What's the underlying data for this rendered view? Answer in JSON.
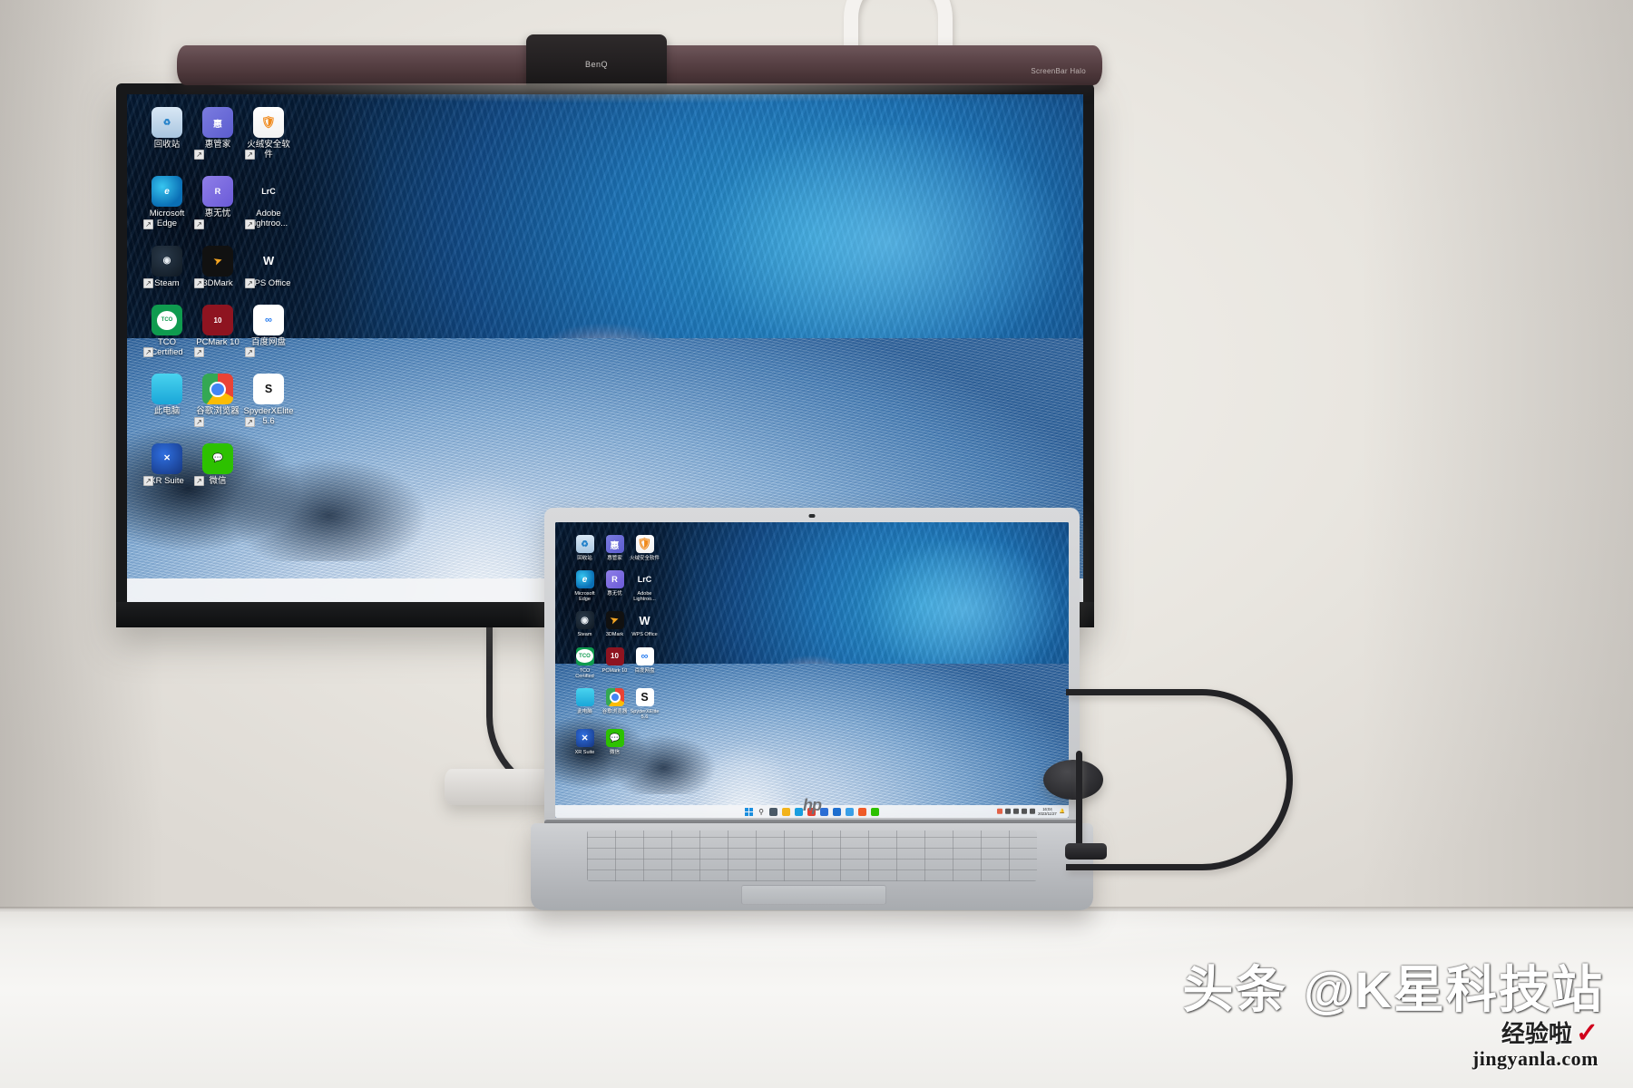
{
  "scene": {
    "description": "Desk setup photo: BenQ ScreenBar Halo light bar on a monitor, HP laptop in front, both showing the same Windows 11 ice-cave wallpaper desktop"
  },
  "lightbar": {
    "brand": "BenQ",
    "model": "ScreenBar Halo"
  },
  "laptop": {
    "brand_logo": "hp"
  },
  "monitor_desktop": {
    "icons": [
      {
        "label": "回收站",
        "icon": "recycle-bin-icon",
        "shortcut": false
      },
      {
        "label": "惠管家",
        "icon": "hui-manager-icon",
        "shortcut": true
      },
      {
        "label": "火绒安全软件",
        "icon": "huorong-security-icon",
        "shortcut": true
      },
      {
        "label": "Microsoft Edge",
        "icon": "microsoft-edge-icon",
        "shortcut": true
      },
      {
        "label": "惠无忧",
        "icon": "huiwuyou-icon",
        "shortcut": true
      },
      {
        "label": "Adobe Lightroo...",
        "icon": "adobe-lightroom-classic-icon",
        "shortcut": true
      },
      {
        "label": "Steam",
        "icon": "steam-icon",
        "shortcut": true
      },
      {
        "label": "3DMark",
        "icon": "3dmark-icon",
        "shortcut": true
      },
      {
        "label": "WPS Office",
        "icon": "wps-office-icon",
        "shortcut": true
      },
      {
        "label": "TCO Certified",
        "icon": "tco-certified-icon",
        "shortcut": true
      },
      {
        "label": "PCMark 10",
        "icon": "pcmark-10-icon",
        "shortcut": true
      },
      {
        "label": "百度网盘",
        "icon": "baidu-netdisk-icon",
        "shortcut": true
      },
      {
        "label": "此电脑",
        "icon": "this-pc-icon",
        "shortcut": false
      },
      {
        "label": "谷歌浏览器",
        "icon": "google-chrome-icon",
        "shortcut": true
      },
      {
        "label": "SpyderXElite 5.6",
        "icon": "spyderx-elite-icon",
        "shortcut": true
      },
      {
        "label": "XR Suite",
        "icon": "xr-suite-icon",
        "shortcut": true
      },
      {
        "label": "微信",
        "icon": "wechat-icon",
        "shortcut": true
      }
    ],
    "taskbar": {
      "items": [
        {
          "name": "start-button",
          "icon": "windows-logo-icon"
        },
        {
          "name": "search-button",
          "icon": "search-icon"
        },
        {
          "name": "widgets-button",
          "icon": "widgets-icon"
        }
      ]
    }
  },
  "laptop_desktop": {
    "icons": [
      {
        "label": "回收站",
        "icon": "recycle-bin-icon"
      },
      {
        "label": "惠管家",
        "icon": "hui-manager-icon"
      },
      {
        "label": "火绒安全软件",
        "icon": "huorong-security-icon"
      },
      {
        "label": "Microsoft Edge",
        "icon": "microsoft-edge-icon"
      },
      {
        "label": "惠无忧",
        "icon": "huiwuyou-icon"
      },
      {
        "label": "Adobe Lightroo...",
        "icon": "adobe-lightroom-classic-icon"
      },
      {
        "label": "Steam",
        "icon": "steam-icon"
      },
      {
        "label": "3DMark",
        "icon": "3dmark-icon"
      },
      {
        "label": "WPS Office",
        "icon": "wps-office-icon"
      },
      {
        "label": "TCO Certified",
        "icon": "tco-certified-icon"
      },
      {
        "label": "PCMark 10",
        "icon": "pcmark-10-icon"
      },
      {
        "label": "百度网盘",
        "icon": "baidu-netdisk-icon"
      },
      {
        "label": "此电脑",
        "icon": "this-pc-icon"
      },
      {
        "label": "谷歌浏览器",
        "icon": "google-chrome-icon"
      },
      {
        "label": "SpyderXElite 5.6",
        "icon": "spyderx-elite-icon"
      },
      {
        "label": "XR Suite",
        "icon": "xr-suite-icon"
      },
      {
        "label": "微信",
        "icon": "wechat-icon"
      }
    ],
    "taskbar": {
      "pinned": [
        {
          "name": "start-button",
          "icon": "windows-logo-icon"
        },
        {
          "name": "search-button",
          "icon": "search-icon"
        },
        {
          "name": "taskview-button",
          "icon": "task-view-icon"
        },
        {
          "name": "explorer-button",
          "icon": "file-explorer-icon"
        },
        {
          "name": "edge-button",
          "icon": "microsoft-edge-icon"
        },
        {
          "name": "chrome-button",
          "icon": "google-chrome-icon"
        },
        {
          "name": "store-button",
          "icon": "microsoft-store-icon"
        },
        {
          "name": "mail-button",
          "icon": "mail-icon"
        },
        {
          "name": "photos-button",
          "icon": "photos-icon"
        },
        {
          "name": "wps-button",
          "icon": "wps-office-icon"
        },
        {
          "name": "wechat-button",
          "icon": "wechat-icon"
        }
      ],
      "tray": [
        {
          "name": "huorong-tray-icon",
          "icon": "shield-icon",
          "color": "#e24a2a"
        },
        {
          "name": "input-method-tray-icon",
          "icon": "ime-icon",
          "color": "#3a3a3a"
        },
        {
          "name": "wifi-tray-icon",
          "icon": "wifi-icon",
          "color": "#3a3a3a"
        },
        {
          "name": "volume-tray-icon",
          "icon": "speaker-icon",
          "color": "#3a3a3a"
        },
        {
          "name": "battery-tray-icon",
          "icon": "battery-icon",
          "color": "#3a3a3a"
        }
      ],
      "clock": {
        "time": "16:04",
        "date": "2023/11/27"
      },
      "notification_icon": "bell-icon"
    }
  },
  "watermark": {
    "main": "头条 @K星科技站",
    "cn": "经验啦",
    "check": "✓",
    "url": "jingyanla.com"
  },
  "colors": {
    "accent": "#1a8fe0",
    "wallpaper_ice": "#1d74b8",
    "wallpaper_snow": "#cfe0f2",
    "watermark_red": "#d0021b"
  }
}
